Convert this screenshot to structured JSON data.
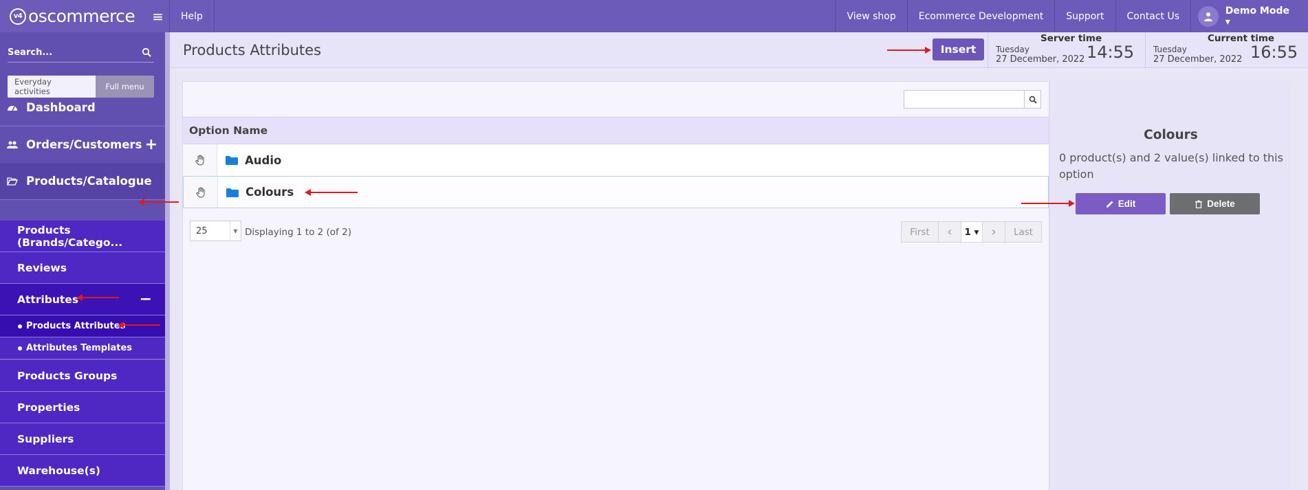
{
  "topbar": {
    "logo_text": "oscommerce",
    "logo_mark": "v4",
    "help": "Help",
    "view_shop": "View shop",
    "ecommerce_dev": "Ecommerce Development",
    "support": "Support",
    "contact": "Contact Us",
    "user": "Demo Mode ▾"
  },
  "sidebar": {
    "search_placeholder": "Search...",
    "everyday": "Everyday activities",
    "full_menu": "Full menu",
    "dashboard": "Dashboard",
    "orders": "Orders/Customers",
    "products": "Products/Catalogue",
    "sub": {
      "brands": "Products (Brands/Catego...",
      "reviews": "Reviews",
      "attributes": "Attributes",
      "products_attributes": "Products Attributes",
      "attributes_templates": "Attributes Templates",
      "groups": "Products Groups",
      "properties": "Properties",
      "suppliers": "Suppliers",
      "warehouses": "Warehouse(s)"
    }
  },
  "header": {
    "title": "Products Attributes",
    "insert": "Insert",
    "server_label": "Server time",
    "server_day": "Tuesday",
    "server_date": "27 December, 2022",
    "server_clock": "14:55",
    "current_label": "Current time",
    "current_day": "Tuesday",
    "current_date": "27 December, 2022",
    "current_clock": "16:55"
  },
  "table": {
    "column": "Option Name",
    "rows": [
      {
        "name": "Audio"
      },
      {
        "name": "Colours"
      }
    ],
    "per_page": "25",
    "displaying": "Displaying 1 to 2 (of 2)",
    "pager": {
      "first": "First",
      "prev": "‹",
      "page": "1",
      "next": "›",
      "last": "Last"
    }
  },
  "info": {
    "title": "Colours",
    "desc": "0 product(s) and 2 value(s) linked to this option",
    "edit": "Edit",
    "delete": "Delete"
  },
  "colors": {
    "topbar": "#6c5bb8",
    "sidebar": "#6150b0",
    "submenu": "#4f28c4",
    "accent": "#7b5cc4",
    "annotation": "#e0191b"
  }
}
